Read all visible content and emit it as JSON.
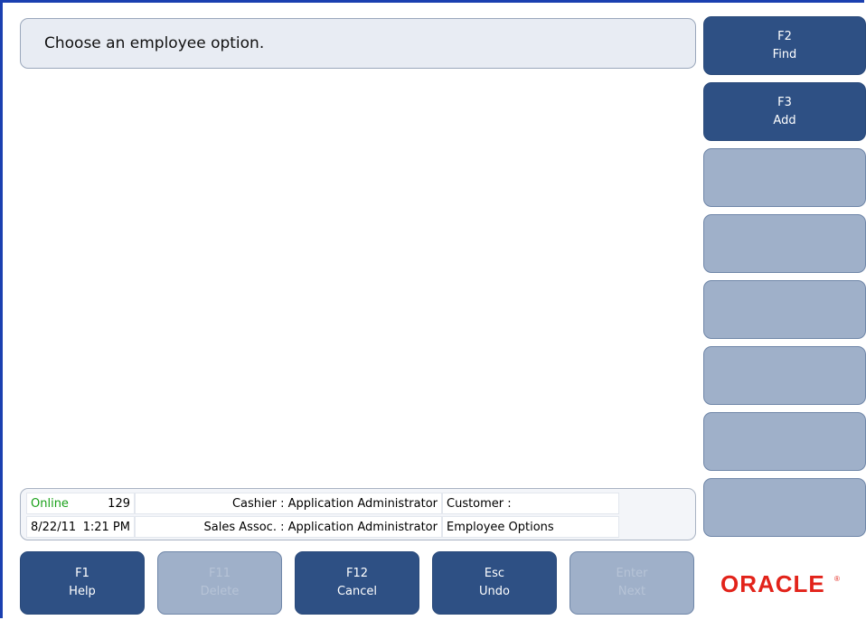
{
  "prompt": "Choose an employee option.",
  "side_buttons": [
    {
      "key": "F2",
      "label": "Find",
      "enabled": true
    },
    {
      "key": "F3",
      "label": "Add",
      "enabled": true
    },
    {
      "key": "",
      "label": "",
      "enabled": false
    },
    {
      "key": "",
      "label": "",
      "enabled": false
    },
    {
      "key": "",
      "label": "",
      "enabled": false
    },
    {
      "key": "",
      "label": "",
      "enabled": false
    },
    {
      "key": "",
      "label": "",
      "enabled": false
    },
    {
      "key": "",
      "label": "",
      "enabled": false
    }
  ],
  "bottom_buttons": [
    {
      "key": "F1",
      "label": "Help",
      "enabled": true
    },
    {
      "key": "F11",
      "label": "Delete",
      "enabled": false
    },
    {
      "key": "F12",
      "label": "Cancel",
      "enabled": true
    },
    {
      "key": "Esc",
      "label": "Undo",
      "enabled": true
    },
    {
      "key": "Enter",
      "label": "Next",
      "enabled": false
    }
  ],
  "status": {
    "connection": "Online",
    "register": "129",
    "cashier": "Cashier : Application Administrator",
    "customer": "Customer :",
    "date": "8/22/11",
    "time": "1:21 PM",
    "sales_assoc": "Sales Assoc. : Application Administrator",
    "screen": "Employee Options"
  },
  "brand": "ORACLE",
  "colors": {
    "accent": "#2e5084",
    "disabled": "#9fb0c9",
    "online": "#19a019",
    "brand": "#e2231a"
  }
}
